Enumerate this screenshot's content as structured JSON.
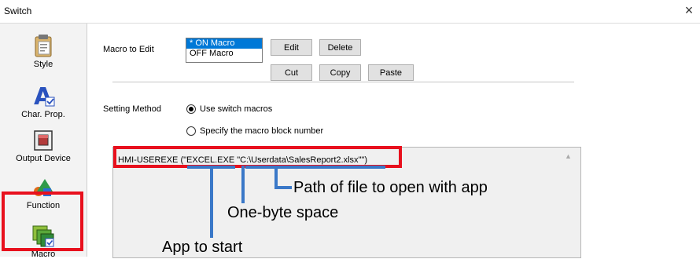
{
  "window": {
    "title": "Switch"
  },
  "sidebar": {
    "items": [
      {
        "label": "Style"
      },
      {
        "label": "Char. Prop."
      },
      {
        "label": "Output Device"
      },
      {
        "label": "Function"
      },
      {
        "label": "Macro"
      }
    ]
  },
  "macro_to_edit": {
    "label": "Macro to Edit",
    "options": [
      "* ON Macro",
      "OFF Macro"
    ],
    "selected": "* ON Macro"
  },
  "buttons": {
    "edit": "Edit",
    "delete": "Delete",
    "cut": "Cut",
    "copy": "Copy",
    "paste": "Paste"
  },
  "setting_method": {
    "label": "Setting Method",
    "option1": "Use switch macros",
    "option2": "Specify the macro block number",
    "selected": "Use switch macros"
  },
  "editor": {
    "line1": "HMI-USEREXE (\"EXCEL.EXE \"C:\\Userdata\\SalesReport2.xlsx\"\")"
  },
  "annotations": {
    "path": "Path of file to open with app",
    "space": "One-byte space",
    "app": "App to start"
  },
  "colors": {
    "highlight_red": "#e8101d",
    "annotation_blue": "#3a78c8",
    "selection_blue": "#0078d7"
  }
}
